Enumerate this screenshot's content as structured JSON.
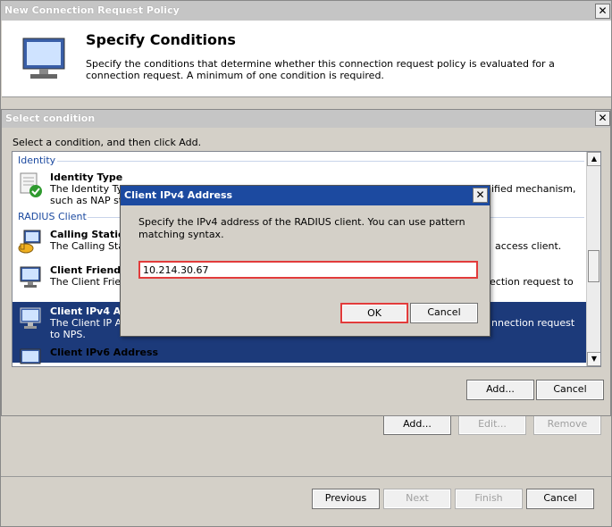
{
  "wizard": {
    "title": "New Connection Request Policy",
    "heading": "Specify Conditions",
    "description": "Specify the conditions that determine whether this connection request policy is evaluated for a connection request. A minimum of one condition is required.",
    "add_label": "Add...",
    "edit_label": "Edit...",
    "remove_label": "Remove",
    "previous_label": "Previous",
    "next_label": "Next",
    "finish_label": "Finish",
    "cancel_label": "Cancel"
  },
  "select_condition": {
    "title": "Select condition",
    "prompt": "Select a condition, and then click Add.",
    "groups": [
      {
        "label": "Identity"
      },
      {
        "label": "RADIUS Client"
      }
    ],
    "items": [
      {
        "title": "Identity Type",
        "desc_visible_1": "The Identity Typ",
        "desc_right_1": "ified mechanism,",
        "desc_visible_2": "such as NAP sta"
      },
      {
        "title": "Calling Station",
        "desc_visible_1": "The Calling Stat",
        "desc_right_1": "access client."
      },
      {
        "title": "Client Friendly",
        "desc_visible_1": "The Client Frien",
        "desc_right_1": "ection request to"
      },
      {
        "title": "Client IPv4 Add",
        "desc_visible_1": "The Client IP Ad",
        "desc_right_1": "nnection request",
        "desc_visible_2": "to NPS."
      },
      {
        "title": "Client IPv6 Address"
      }
    ],
    "add_label": "Add...",
    "cancel_label": "Cancel"
  },
  "ip_dialog": {
    "title": "Client IPv4 Address",
    "instructions": "Specify the IPv4 address of the RADIUS client. You can use pattern matching syntax.",
    "ip_value": "10.214.30.67",
    "ok_label": "OK",
    "cancel_label": "Cancel"
  },
  "colors": {
    "accent": "#1c4aa0",
    "highlight": "#e23b3b",
    "selection": "#1c3a7a"
  }
}
